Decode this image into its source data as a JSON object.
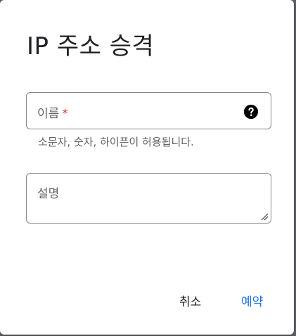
{
  "dialog": {
    "title": "IP 주소 승격",
    "name_field": {
      "label": "이름",
      "required_mark": "*",
      "help_icon": "help-circle-icon",
      "hint": "소문자, 숫자, 하이픈이 허용됩니다."
    },
    "description_field": {
      "label": "설명"
    },
    "buttons": {
      "cancel": "취소",
      "reserve": "예약"
    }
  },
  "colors": {
    "accent": "#1a73e8",
    "required": "#d93025",
    "border": "#80868b",
    "secondary_text": "#5f6368",
    "primary_text": "#202124"
  }
}
